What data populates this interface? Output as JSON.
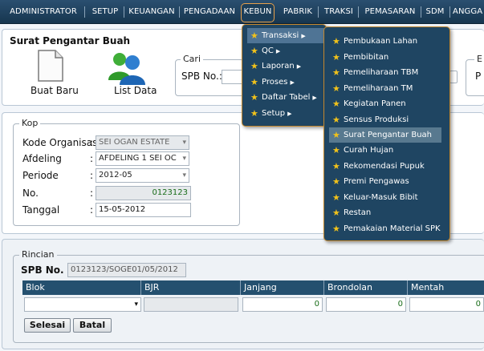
{
  "nav": {
    "items": [
      "ADMINISTRATOR",
      "SETUP",
      "KEUANGAN",
      "PENGADAAN",
      "KEBUN",
      "PABRIK",
      "TRAKSI",
      "PEMASARAN",
      "SDM",
      "ANGGA"
    ]
  },
  "header": {
    "title": "Surat Pengantar Buah"
  },
  "toolbar": {
    "new_label": "Buat Baru",
    "list_label": "List Data"
  },
  "cari": {
    "legend": "Cari",
    "spb_label": "SPB No.:"
  },
  "panel_e": {
    "legend": "E",
    "label": "P"
  },
  "kop": {
    "legend": "Kop",
    "kode_organisasi_label": "Kode Organisasi",
    "kode_organisasi_value": "SEI OGAN ESTATE",
    "afdeling_label": "Afdeling",
    "afdeling_value": "AFDELING 1 SEI OC",
    "periode_label": "Periode",
    "periode_value": "2012-05",
    "no_label": "No.",
    "no_value": "0123123",
    "tanggal_label": "Tanggal",
    "tanggal_value": "15-05-2012",
    "colon": ":"
  },
  "rincian": {
    "legend": "Rincian",
    "spb_label": "SPB No. :",
    "spb_value": "0123123/SOGE01/05/2012",
    "columns": [
      "Blok",
      "BJR",
      "Janjang",
      "Brondolan",
      "Mentah"
    ],
    "row": {
      "janjang": "0",
      "brondolan": "0",
      "mentah": "0"
    },
    "selesai_label": "Selesai",
    "batal_label": "Batal"
  },
  "menu_kebun": {
    "items": [
      "Transaksi",
      "QC",
      "Laporan",
      "Proses",
      "Daftar Tabel",
      "Setup"
    ]
  },
  "menu_transaksi": {
    "items": [
      "Pembukaan Lahan",
      "Pembibitan",
      "Pemeliharaan TBM",
      "Pemeliharaan TM",
      "Kegiatan Panen",
      "Sensus Produksi",
      "Surat Pengantar Buah",
      "Curah Hujan",
      "Rekomendasi Pupuk",
      "Premi Pengawas",
      "Keluar-Masuk Bibit",
      "Restan",
      "Pemakaian Material SPK"
    ]
  },
  "colors": {
    "nav_bg": "#1f4562",
    "menu_border": "#c5892f",
    "star": "#f1c21b"
  }
}
